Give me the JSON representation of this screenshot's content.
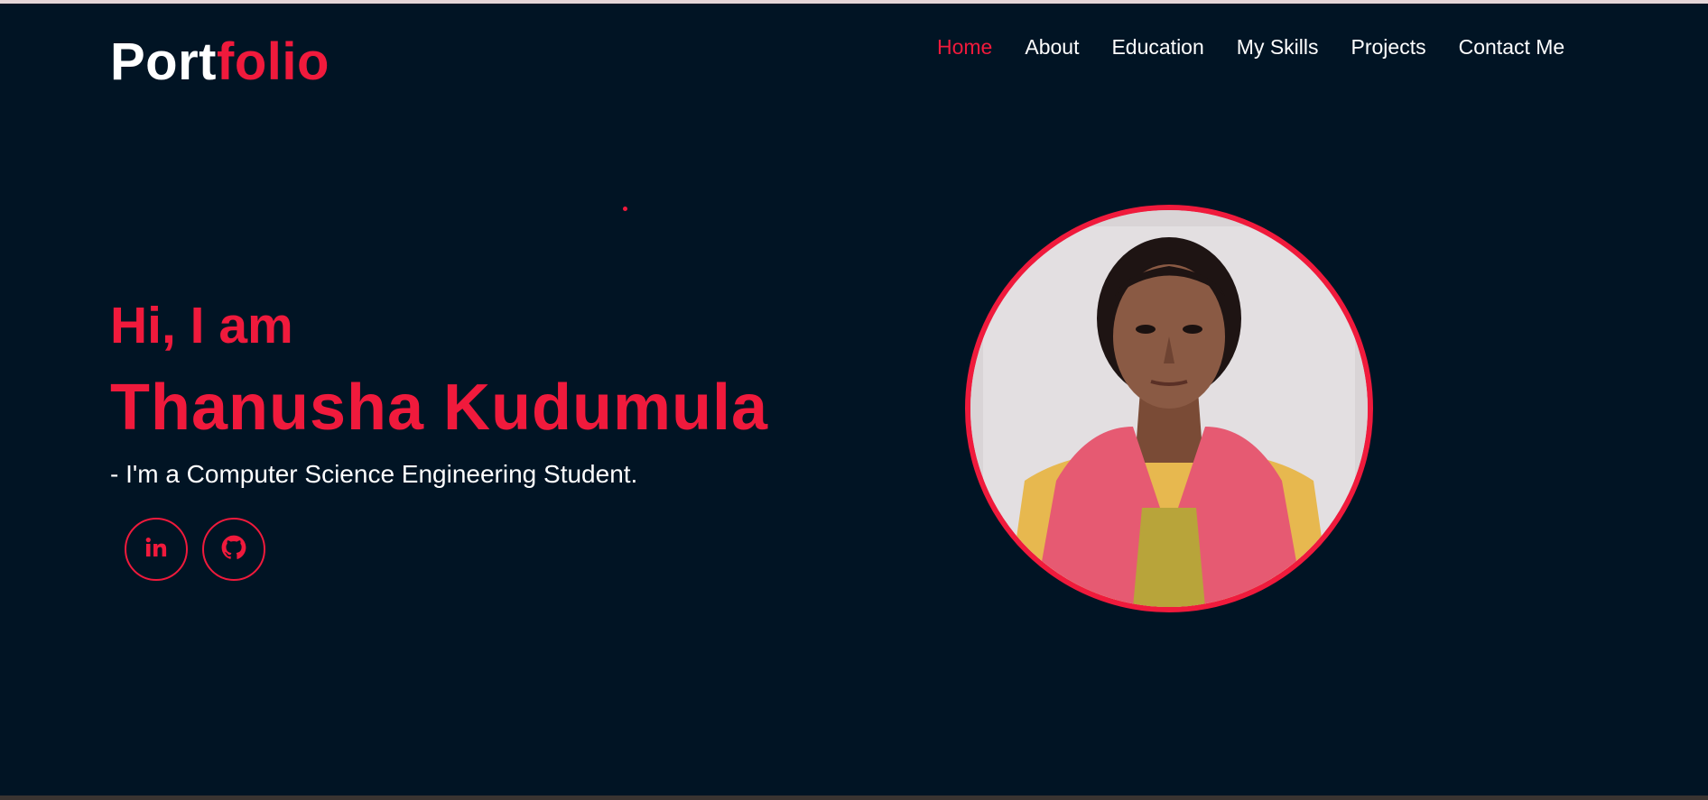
{
  "header": {
    "logo_part1": "Port",
    "logo_part2": "folio",
    "nav": [
      {
        "label": "Home"
      },
      {
        "label": "About"
      },
      {
        "label": "Education"
      },
      {
        "label": "My Skills"
      },
      {
        "label": "Projects"
      },
      {
        "label": "Contact Me"
      }
    ]
  },
  "hero": {
    "greeting": "Hi, I am",
    "name": "Thanusha Kudumula",
    "tagline": "- I'm a Computer Science Engineering Student.",
    "socials": [
      {
        "icon": "linkedin-icon"
      },
      {
        "icon": "github-icon"
      }
    ]
  },
  "colors": {
    "background": "#011424",
    "accent": "#f01a3c",
    "text": "#ffffff"
  }
}
